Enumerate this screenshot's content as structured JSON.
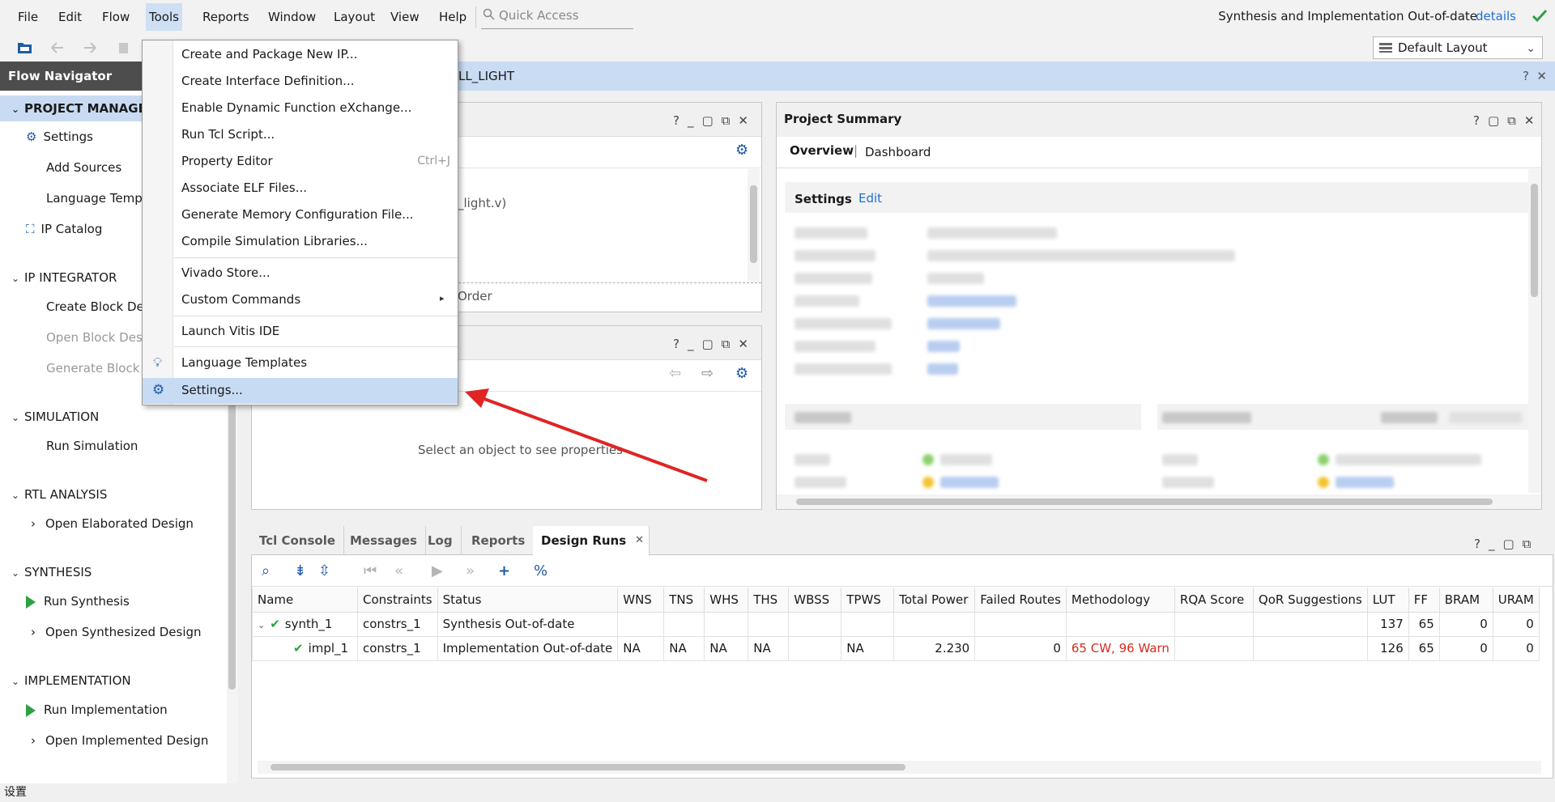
{
  "menubar": {
    "items": [
      "File",
      "Edit",
      "Flow",
      "Tools",
      "Reports",
      "Window",
      "Layout",
      "View",
      "Help"
    ],
    "quick_access_placeholder": "Quick Access",
    "status": "Synthesis and Implementation Out-of-date",
    "details": "details"
  },
  "toolbar": {
    "layout": "Default Layout"
  },
  "flow_navigator": {
    "title": "Flow Navigator",
    "sections": {
      "project_manager": "PROJECT MANAGER",
      "ip_integrator": "IP INTEGRATOR",
      "simulation": "SIMULATION",
      "rtl_analysis": "RTL ANALYSIS",
      "synthesis": "SYNTHESIS",
      "implementation": "IMPLEMENTATION"
    },
    "items": {
      "settings": "Settings",
      "add_sources": "Add Sources",
      "language_templates": "Language Templates",
      "ip_catalog": "IP Catalog",
      "create_block_design": "Create Block Design",
      "open_block_design": "Open Block Design",
      "generate_block_design": "Generate Block Design",
      "run_simulation": "Run Simulation",
      "open_elaborated": "Open Elaborated Design",
      "run_synthesis": "Run Synthesis",
      "open_synthesized": "Open Synthesized Design",
      "run_implementation": "Run Implementation",
      "open_implemented": "Open Implemented Design"
    }
  },
  "project_bar": {
    "title_suffix": "LL_LIGHT"
  },
  "sources_panel": {
    "file_fragment": "_light.v)",
    "tab_fragment": "Order"
  },
  "properties_panel": {
    "empty_text": "Select an object to see properties"
  },
  "project_summary": {
    "title": "Project Summary",
    "tabs": [
      "Overview",
      "Dashboard"
    ],
    "settings_label": "Settings",
    "edit_label": "Edit"
  },
  "tools_menu": {
    "items": [
      "Create and Package New IP...",
      "Create Interface Definition...",
      "Enable Dynamic Function eXchange...",
      "Run Tcl Script...",
      "Property Editor",
      "Associate ELF Files...",
      "Generate Memory Configuration File...",
      "Compile Simulation Libraries...",
      "Vivado Store...",
      "Custom Commands",
      "Launch Vitis IDE",
      "Language Templates",
      "Settings..."
    ],
    "property_editor_shortcut": "Ctrl+J"
  },
  "bottom_tabs": [
    "Tcl Console",
    "Messages",
    "Log",
    "Reports",
    "Design Runs"
  ],
  "design_runs": {
    "columns": [
      "Name",
      "Constraints",
      "Status",
      "WNS",
      "TNS",
      "WHS",
      "THS",
      "WBSS",
      "TPWS",
      "Total Power",
      "Failed Routes",
      "Methodology",
      "RQA Score",
      "QoR Suggestions",
      "LUT",
      "FF",
      "BRAM",
      "URAM"
    ],
    "rows": [
      [
        "synth_1",
        "constrs_1",
        "Synthesis Out-of-date",
        "",
        "",
        "",
        "",
        "",
        "",
        "",
        "",
        "",
        "",
        "",
        "137",
        "65",
        "0",
        "0"
      ],
      [
        "impl_1",
        "constrs_1",
        "Implementation Out-of-date",
        "NA",
        "NA",
        "NA",
        "NA",
        "",
        "NA",
        "2.230",
        "0",
        "65 CW, 96 Warn",
        "",
        "",
        "126",
        "65",
        "0",
        "0"
      ]
    ]
  },
  "statusbar": {
    "text": "设置"
  },
  "colors": {
    "accent": "#1e6fd9",
    "highlight": "#c8dbf2",
    "warning": "#d62c1f",
    "arrow": "#e02424"
  }
}
